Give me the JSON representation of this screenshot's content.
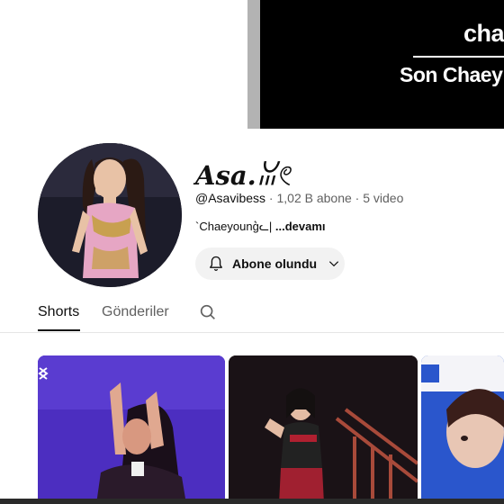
{
  "banner": {
    "title": "cha",
    "subtitle": "Son Chaey"
  },
  "channel": {
    "name": "Asa.ꈍ𓏲",
    "handle": "@Asavibess",
    "subscribers": "1,02 B abone",
    "videos": "5 video",
    "separator": "·",
    "description": "`Chaeyoung͛ᓚ|",
    "more_label": "...devamı"
  },
  "subscribe": {
    "label": "Abone olundu"
  },
  "tabs": [
    {
      "label": "Shorts"
    },
    {
      "label": "Gönderiler"
    }
  ],
  "icons": {
    "bell": "bell-icon",
    "chevron": "chevron-down-icon",
    "search": "search-icon"
  }
}
